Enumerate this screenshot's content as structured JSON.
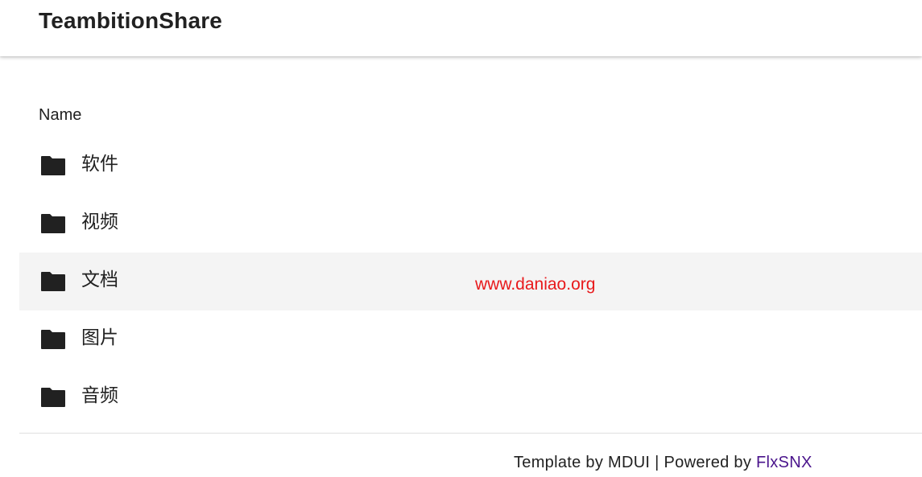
{
  "header": {
    "title": "TeambitionShare"
  },
  "list": {
    "column_name": "Name",
    "items": [
      {
        "label": "软件",
        "icon": "folder-icon"
      },
      {
        "label": "视频",
        "icon": "folder-icon"
      },
      {
        "label": "文档",
        "icon": "folder-icon"
      },
      {
        "label": "图片",
        "icon": "folder-icon"
      },
      {
        "label": "音频",
        "icon": "folder-icon"
      }
    ],
    "hovered_index": 2
  },
  "watermark": {
    "text": "www.daniao.org",
    "color": "#e8191b"
  },
  "footer": {
    "template_text": "Template by MDUI",
    "separator": "|",
    "powered_text": "Powered by",
    "powered_link": "FlxSNX",
    "link_color": "#4a148c"
  }
}
